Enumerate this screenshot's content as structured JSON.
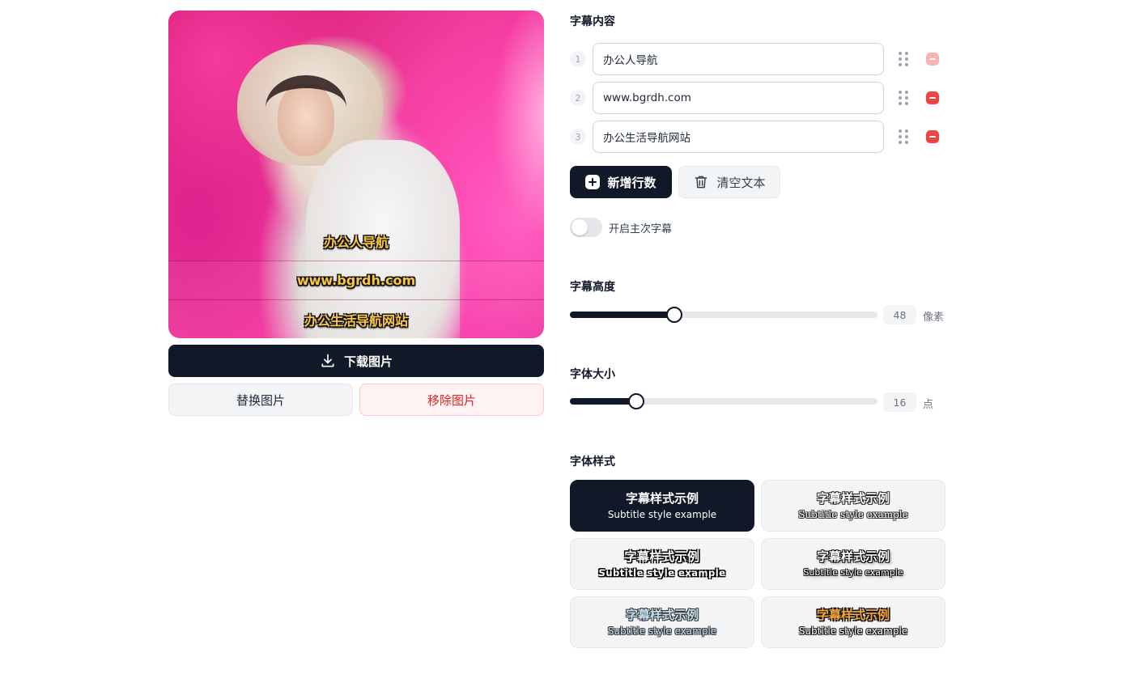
{
  "preview": {
    "subtitle_lines": [
      "办公人导航",
      "www.bgrdh.com",
      "办公生活导航网站"
    ],
    "subtitle_color": "#f9c646"
  },
  "actions": {
    "download_label": "下载图片",
    "replace_label": "替换图片",
    "remove_label": "移除图片"
  },
  "content": {
    "title": "字幕内容",
    "lines": [
      {
        "num": "1",
        "value": "办公人导航",
        "delete_enabled": false
      },
      {
        "num": "2",
        "value": "www.bgrdh.com",
        "delete_enabled": true
      },
      {
        "num": "3",
        "value": "办公生活导航网站",
        "delete_enabled": true
      }
    ],
    "add_label": "新增行数",
    "clear_label": "清空文本",
    "secondary_toggle_label": "开启主次字幕",
    "secondary_toggle_on": false
  },
  "height": {
    "title": "字幕高度",
    "value": "48",
    "unit": "像素",
    "fraction": 0.34
  },
  "font_size": {
    "title": "字体大小",
    "value": "16",
    "unit": "点",
    "fraction": 0.215
  },
  "font_style": {
    "title": "字体样式",
    "options": [
      {
        "zh": "字幕样式示例",
        "en": "Subtitle style example",
        "selected": true
      },
      {
        "zh": "字幕样式示例",
        "en": "Subtitle style example",
        "selected": false
      },
      {
        "zh": "字幕样式示例",
        "en": "Subtitle style example",
        "selected": false
      },
      {
        "zh": "字幕样式示例",
        "en": "Subtitle style example",
        "selected": false
      },
      {
        "zh": "字幕样式示例",
        "en": "Subtitle style example",
        "selected": false
      },
      {
        "zh": "字幕样式示例",
        "en": "Subtitle style example",
        "selected": false
      }
    ]
  },
  "colors": {
    "primary": "#111827",
    "danger": "#ef4444",
    "danger_bg": "#fef2f2"
  },
  "icons": {
    "download": "download-icon",
    "trash": "trash-icon",
    "plus": "plus-square-icon",
    "drag": "drag-handle-icon",
    "delete": "minus-icon"
  }
}
